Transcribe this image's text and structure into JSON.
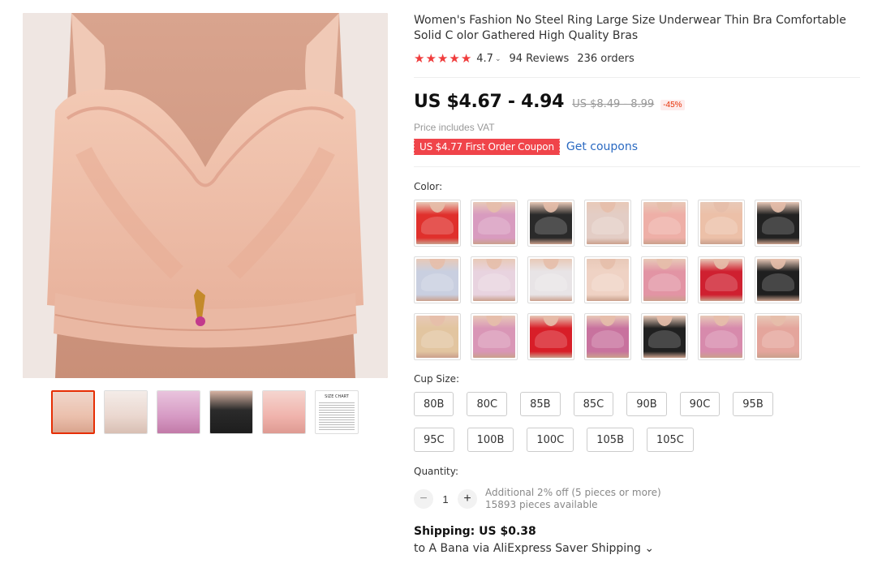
{
  "product": {
    "title": "Women's Fashion No Steel Ring Large Size Underwear Thin Bra Comfortable Solid C olor Gathered High Quality Bras",
    "rating": "4.7",
    "stars": 5,
    "reviews": "94 Reviews",
    "orders": "236 orders",
    "price": "US $4.67 - 4.94",
    "old_price": "US $8.49 - 8.99",
    "discount": "-45%",
    "vat_note": "Price includes VAT",
    "coupon": "US $4.77 First Order Coupon",
    "get_coupons": "Get coupons"
  },
  "gallery": {
    "main_color": "#ecc3ae",
    "thumbnails": [
      {
        "color": "#ebc0ad",
        "active": true
      },
      {
        "color": "#ead7cf",
        "active": false
      },
      {
        "color": "#d69ac4",
        "active": false
      },
      {
        "color": "#2b2b2b",
        "active": false
      },
      {
        "color": "#f0b3ac",
        "active": false
      },
      {
        "type": "size-chart",
        "label": "SIZE CHART"
      }
    ]
  },
  "color": {
    "label": "Color:",
    "options": [
      "#e0302c",
      "#d89bbf",
      "#2a2a2a",
      "#e3cdc5",
      "#eeafa7",
      "#ecc0a8",
      "#222222",
      "#c9cfe0",
      "#e8d3df",
      "#e8e4e6",
      "#efd2c4",
      "#e294a4",
      "#cf2030",
      "#1f1f1f",
      "#e2c5a0",
      "#d996b6",
      "#d81e28",
      "#c8729e",
      "#202020",
      "#d78aac",
      "#e4a59c"
    ]
  },
  "cup_size": {
    "label": "Cup Size:",
    "options": [
      "80B",
      "80C",
      "85B",
      "85C",
      "90B",
      "90C",
      "95B",
      "95C",
      "100B",
      "100C",
      "105B",
      "105C"
    ]
  },
  "quantity": {
    "label": "Quantity:",
    "value": "1",
    "minus": "−",
    "plus": "+",
    "note": "Additional 2% off (5 pieces or more)",
    "available": "15893 pieces available"
  },
  "shipping": {
    "title": "Shipping: US $0.38",
    "detail": "to A Bana via AliExpress Saver Shipping ⌄"
  }
}
